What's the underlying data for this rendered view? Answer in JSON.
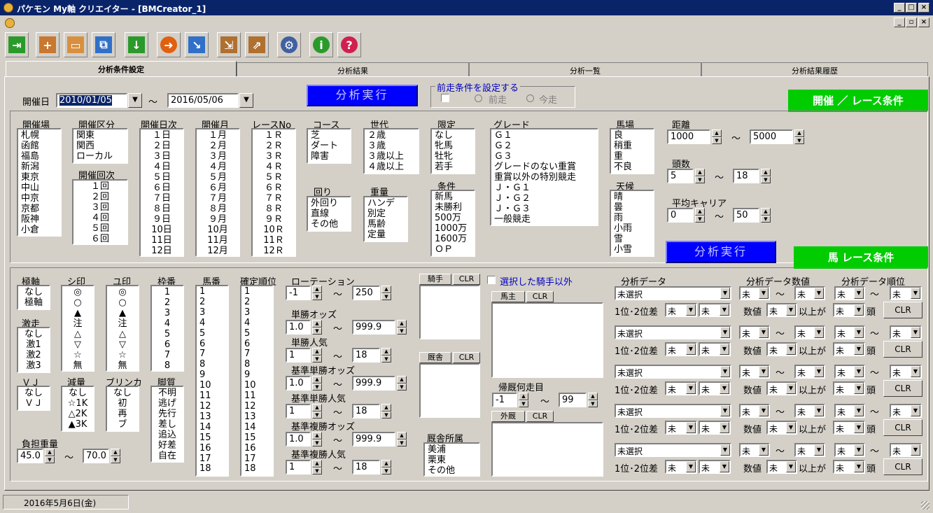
{
  "window": {
    "title": "パケモン My軸 クリエイター - [BMCreator_1]"
  },
  "toolbar": [
    "exit-icon",
    "new-icon",
    "open-icon",
    "copy-icon",
    "download-icon",
    "forward-icon",
    "link-icon",
    "import-icon",
    "export-icon",
    "gear-icon",
    "info-icon",
    "help-icon"
  ],
  "tabs": [
    "分析条件設定",
    "分析結果",
    "分析一覧",
    "分析結果履歴"
  ],
  "top": {
    "date_label": "開催日",
    "date_from": "2010/01/05",
    "tilde": "～",
    "date_to": "2016/05/06",
    "run_button": "分析実行",
    "prev_group": "前走条件を設定する",
    "prev_race": "前走",
    "this_race": "今走",
    "race_cond_title": "開催 ／ レース条件",
    "horse_cond_title": "馬 レース条件"
  },
  "race": {
    "venue": {
      "label": "開催場",
      "items": [
        "札幌",
        "函館",
        "福島",
        "新潟",
        "東京",
        "中山",
        "中京",
        "京都",
        "阪神",
        "小倉"
      ]
    },
    "kubun": {
      "label": "開催区分",
      "items": [
        "関東",
        "関西",
        "ローカル"
      ]
    },
    "kaiji": {
      "label": "開催回次",
      "items": [
        "１回",
        "２回",
        "３回",
        "４回",
        "５回",
        "６回"
      ]
    },
    "nichiji": {
      "label": "開催日次",
      "items": [
        "１日",
        "２日",
        "３日",
        "４日",
        "５日",
        "６日",
        "７日",
        "８日",
        "９日",
        "10日",
        "11日",
        "12日"
      ]
    },
    "month": {
      "label": "開催月",
      "items": [
        "１月",
        "２月",
        "３月",
        "４月",
        "５月",
        "６月",
        "７月",
        "８月",
        "９月",
        "10月",
        "11月",
        "12月"
      ]
    },
    "raceno": {
      "label": "レースNo",
      "items": [
        "１Ｒ",
        "２Ｒ",
        "３Ｒ",
        "４Ｒ",
        "５Ｒ",
        "６Ｒ",
        "７Ｒ",
        "８Ｒ",
        "９Ｒ",
        "10Ｒ",
        "11Ｒ",
        "12Ｒ"
      ]
    },
    "course": {
      "label": "コース",
      "items": [
        "芝",
        "ダート",
        "障害"
      ]
    },
    "turn": {
      "label": "回り",
      "items": [
        "外回り",
        "直線",
        "その他"
      ]
    },
    "age": {
      "label": "世代",
      "items": [
        "２歳",
        "３歳",
        "３歳以上",
        "４歳以上"
      ]
    },
    "weight": {
      "label": "重量",
      "items": [
        "ハンデ",
        "別定",
        "馬齢",
        "定量"
      ]
    },
    "limit": {
      "label": "限定",
      "items": [
        "なし",
        "牝馬",
        "牡牝",
        "若手"
      ]
    },
    "cond": {
      "label": "条件",
      "items": [
        "新馬",
        "未勝利",
        "500万",
        "1000万",
        "1600万",
        "ＯＰ"
      ]
    },
    "grade": {
      "label": "グレード",
      "items": [
        "Ｇ１",
        "Ｇ２",
        "Ｇ３",
        "グレードのない重賞",
        "重賞以外の特別競走",
        "Ｊ・Ｇ１",
        "Ｊ・Ｇ２",
        "Ｊ・Ｇ３",
        "一般競走"
      ]
    },
    "track": {
      "label": "馬場",
      "items": [
        "良",
        "稍重",
        "重",
        "不良"
      ]
    },
    "weather": {
      "label": "天候",
      "items": [
        "晴",
        "曇",
        "雨",
        "小雨",
        "雪",
        "小雪"
      ]
    },
    "distance": {
      "label": "距離",
      "from": "1000",
      "to": "5000"
    },
    "heads": {
      "label": "頭数",
      "from": "5",
      "to": "18"
    },
    "career": {
      "label": "平均キャリア",
      "from": "0",
      "to": "50"
    },
    "run_button": "分析実行"
  },
  "horse": {
    "axis": {
      "label": "極軸",
      "items": [
        "なし",
        "極軸"
      ]
    },
    "shi": {
      "label": "シ印",
      "items": [
        "◎",
        "○",
        "▲",
        "注",
        "△",
        "▽",
        "☆",
        "無"
      ]
    },
    "yu": {
      "label": "ユ印",
      "items": [
        "◎",
        "○",
        "▲",
        "注",
        "△",
        "▽",
        "☆",
        "無"
      ]
    },
    "waku": {
      "label": "枠番",
      "items": [
        "1",
        "2",
        "3",
        "4",
        "5",
        "6",
        "7",
        "8"
      ]
    },
    "umaban": {
      "label": "馬番",
      "items": [
        "1",
        "2",
        "3",
        "4",
        "5",
        "6",
        "7",
        "8",
        "9",
        "10",
        "11",
        "12",
        "13",
        "14",
        "15",
        "16",
        "17",
        "18"
      ]
    },
    "rank": {
      "label": "確定順位",
      "items": [
        "1",
        "2",
        "3",
        "4",
        "5",
        "6",
        "7",
        "8",
        "9",
        "10",
        "11",
        "12",
        "13",
        "14",
        "15",
        "16",
        "17",
        "18"
      ]
    },
    "gekiso": {
      "label": "激走",
      "items": [
        "なし",
        "激1",
        "激2",
        "激3"
      ]
    },
    "vj": {
      "label": "ＶＪ",
      "items": [
        "なし",
        "ＶＪ"
      ]
    },
    "genryo": {
      "label": "減量",
      "items": [
        "なし",
        "☆1K",
        "△2K",
        "▲3K"
      ]
    },
    "blinker": {
      "label": "ブリンカ",
      "items": [
        "なし",
        "初",
        "再",
        "ブ"
      ]
    },
    "kyakushitsu": {
      "label": "脚質",
      "items": [
        "不明",
        "逃げ",
        "先行",
        "差し",
        "追込",
        "好差",
        "自在"
      ]
    },
    "futan": {
      "label": "負担重量",
      "from": "45.0",
      "to": "70.0"
    },
    "rotation": {
      "label": "ローテーション",
      "from": "-1",
      "to": "250"
    },
    "tansho_odds": {
      "label": "単勝オッズ",
      "from": "1.0",
      "to": "999.9"
    },
    "tansho_ninki": {
      "label": "単勝人気",
      "from": "1",
      "to": "18"
    },
    "kijun_tansho_odds": {
      "label": "基準単勝オッズ",
      "from": "1.0",
      "to": "999.9"
    },
    "kijun_tansho_ninki": {
      "label": "基準単勝人気",
      "from": "1",
      "to": "18"
    },
    "kijun_fukusho_odds": {
      "label": "基準複勝オッズ",
      "from": "1.0",
      "to": "999.9"
    },
    "kijun_fukusho_ninki": {
      "label": "基準複勝人気",
      "from": "1",
      "to": "18"
    },
    "jockey": "騎手",
    "trainer": "厩舎",
    "clr": "CLR",
    "except_jockey": "選択した騎手以外",
    "owner": "馬主",
    "kisha": {
      "label": "帰厩何走目",
      "from": "-1",
      "to": "99"
    },
    "gaikyu": "外厩",
    "stable_belong": {
      "label": "厩舎所属",
      "items": [
        "美浦",
        "栗東",
        "その他"
      ]
    },
    "analysis": {
      "col1": "分析データ",
      "col2": "分析データ数値",
      "col3": "分析データ順位",
      "unselected": "未選択",
      "mi": "未",
      "diff_label": "1位･2位差",
      "num_label": "数値",
      "above": "以上が",
      "head": "頭"
    }
  },
  "status": {
    "date": "2016年5月6日(金)"
  },
  "colors": {
    "title_bg": "#0a246a",
    "run_button": "#0000ff",
    "green": "#00cc00"
  }
}
